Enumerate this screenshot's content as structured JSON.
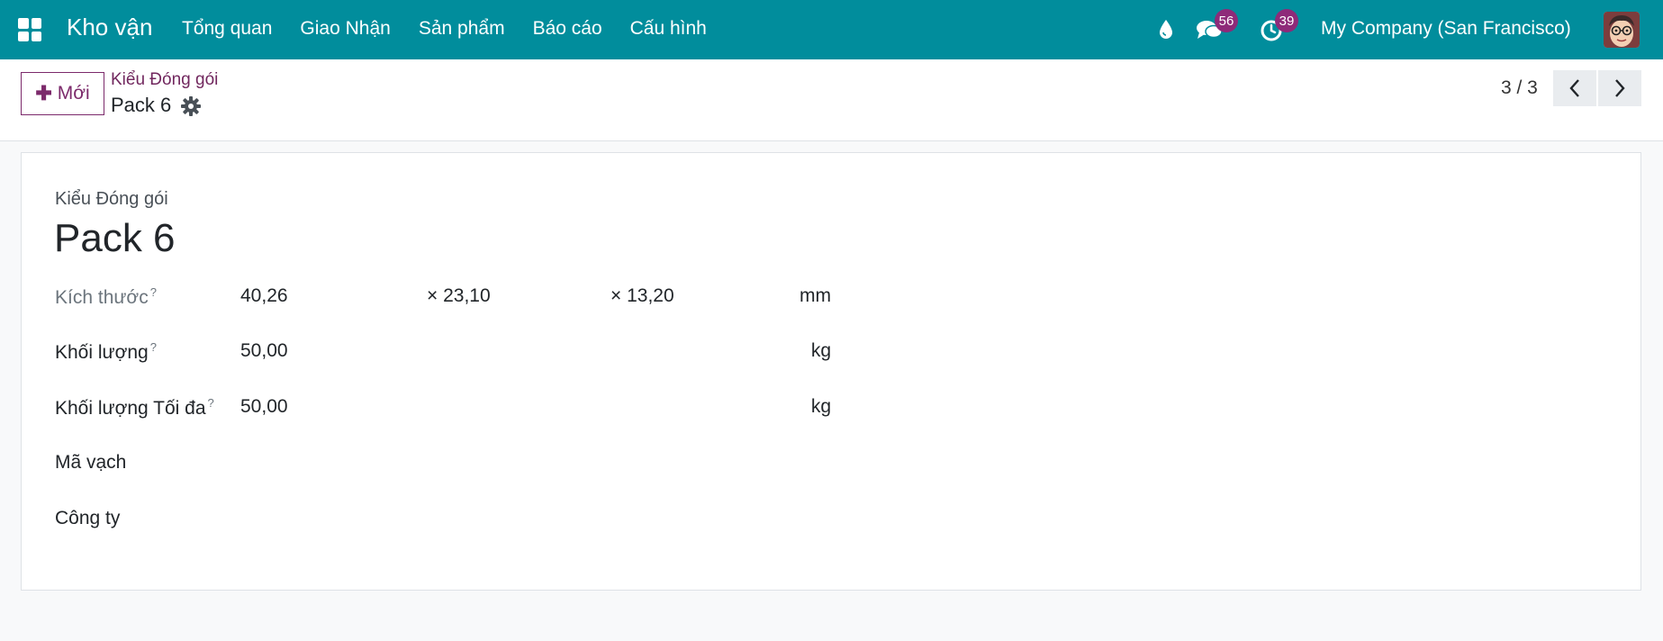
{
  "navbar": {
    "app_name": "Kho vận",
    "menu": [
      "Tổng quan",
      "Giao Nhận",
      "Sản phẩm",
      "Báo cáo",
      "Cấu hình"
    ],
    "messages_count": "56",
    "activities_count": "39",
    "company": "My Company (San Francisco)"
  },
  "control": {
    "new_label": "Mới",
    "breadcrumb": "Kiểu Đóng gói",
    "record": "Pack 6",
    "pager": "3 / 3"
  },
  "form": {
    "model_label": "Kiểu Đóng gói",
    "name": "Pack 6",
    "help_mark": "?",
    "dimensions": {
      "label": "Kích thước",
      "length": "40,26",
      "width": "× 23,10",
      "height": "× 13,20",
      "unit": "mm"
    },
    "weight": {
      "label": "Khối lượng",
      "value": "50,00",
      "unit": "kg"
    },
    "max_weight": {
      "label": "Khối lượng Tối đa",
      "value": "50,00",
      "unit": "kg"
    },
    "barcode": {
      "label": "Mã vạch"
    },
    "company": {
      "label": "Công ty"
    }
  },
  "colors": {
    "navbar": "#018d9c",
    "primary": "#7c2a6b",
    "badge": "#8e2a79"
  }
}
